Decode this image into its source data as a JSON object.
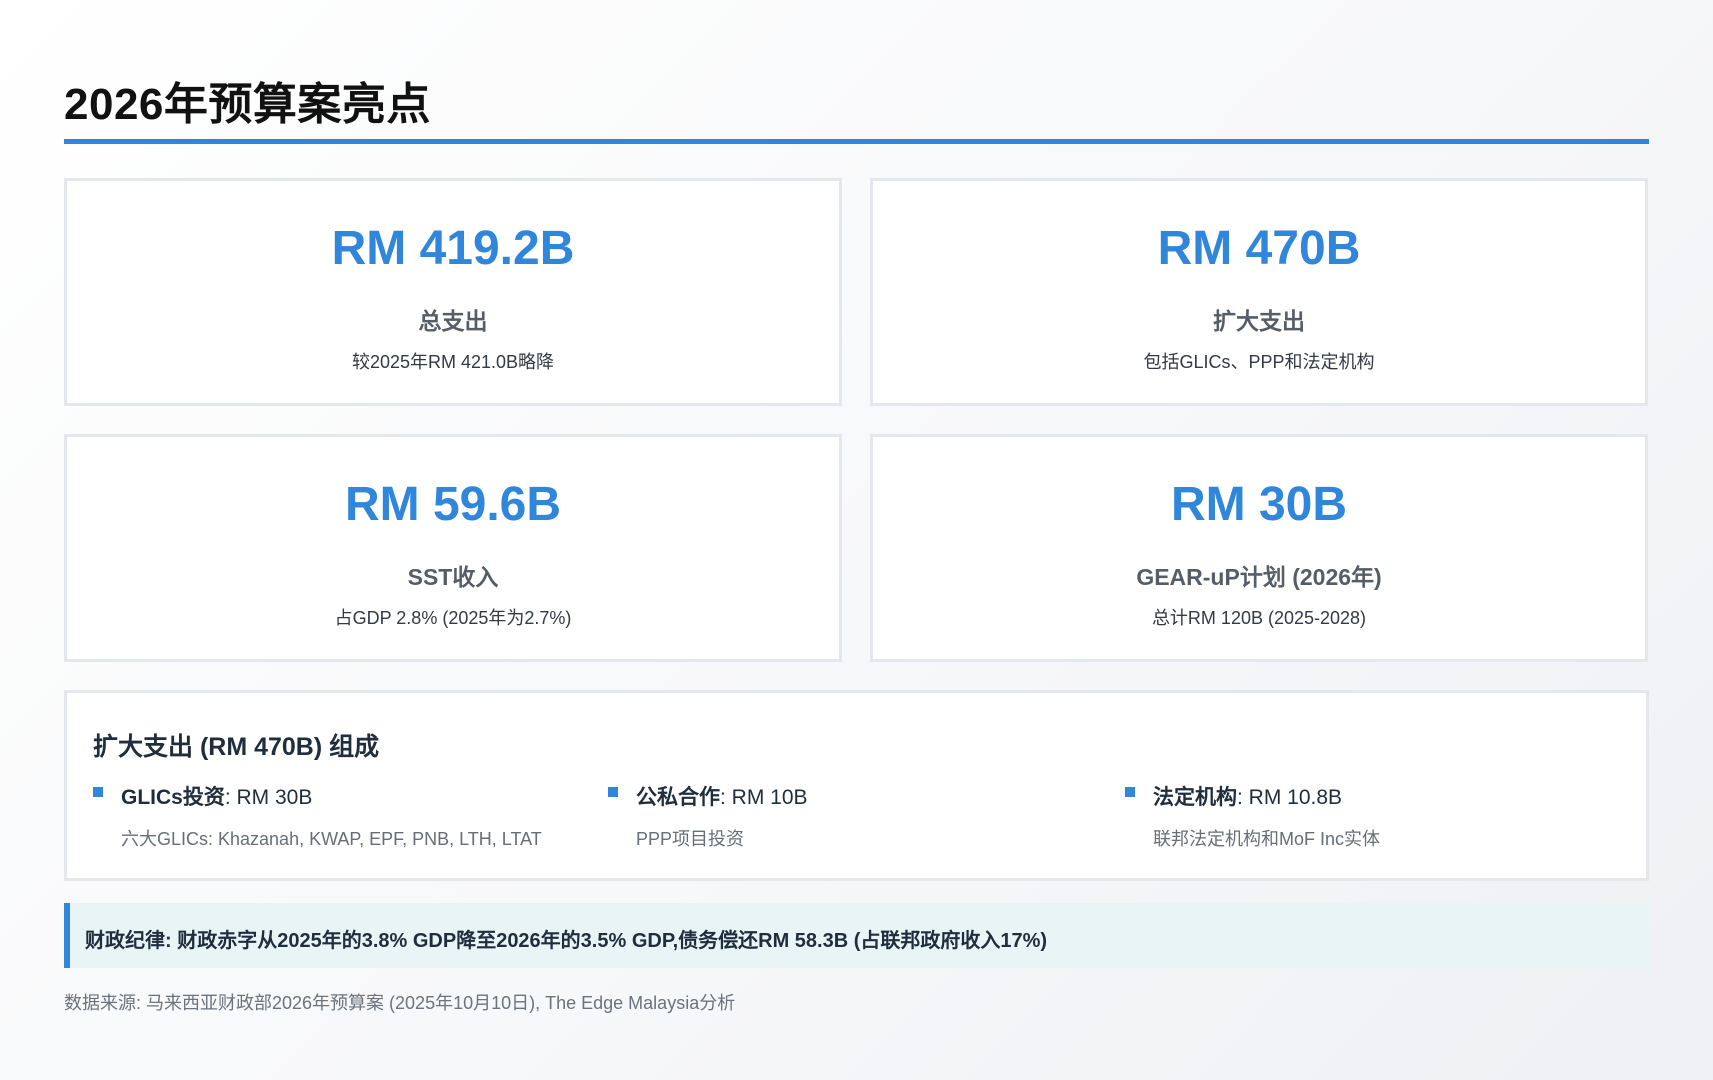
{
  "header": {
    "title": "2026年预算案亮点"
  },
  "stats": [
    {
      "value": "RM 419.2B",
      "label": "总支出",
      "note": "较2025年RM 421.0B略降"
    },
    {
      "value": "RM 470B",
      "label": "扩大支出",
      "note": "包括GLICs、PPP和法定机构"
    },
    {
      "value": "RM 59.6B",
      "label": "SST收入",
      "note": "占GDP 2.8% (2025年为2.7%)"
    },
    {
      "value": "RM 30B",
      "label": "GEAR-uP计划 (2026年)",
      "note": "总计RM 120B (2025-2028)"
    }
  ],
  "breakdown": {
    "title": "扩大支出 (RM 470B) 组成",
    "items": [
      {
        "name": "GLICs投资",
        "amount": ": RM 30B",
        "desc": "六大GLICs: Khazanah, KWAP, EPF, PNB, LTH, LTAT"
      },
      {
        "name": "公私合作",
        "amount": ": RM 10B",
        "desc": "PPP项目投资"
      },
      {
        "name": "法定机构",
        "amount": ": RM 10.8B",
        "desc": "联邦法定机构和MoF Inc实体"
      }
    ]
  },
  "callout": {
    "text": "财政纪律: 财政赤字从2025年的3.8% GDP降至2026年的3.5% GDP,债务偿还RM 58.3B (占联邦政府收入17%)"
  },
  "footer": {
    "source": "数据来源: 马来西亚财政部2026年预算案 (2025年10月10日), The Edge Malaysia分析"
  },
  "colors": {
    "accent": "#2f86db",
    "callout_bg": "#e9f4f6"
  }
}
